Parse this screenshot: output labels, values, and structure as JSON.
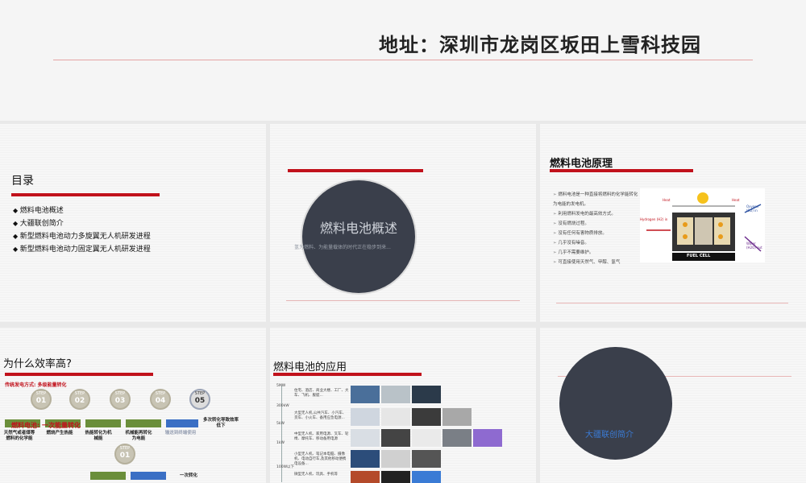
{
  "header": {
    "title": "地址：深圳市龙岗区坂田上雪科技园"
  },
  "slide1": {
    "title": "目录",
    "items": [
      "燃料电池概述",
      "大疆联创简介",
      "新型燃料电池动力多旋翼无人机研发进程",
      "新型燃料电池动力固定翼无人机研发进程"
    ]
  },
  "slide2": {
    "title": "燃料电池概述",
    "subtitle": "氢为燃料、为能量载体的时代正在稳步到来..."
  },
  "slide3": {
    "title": "燃料电池原理",
    "bullets": [
      "燃料电池是一种直接将燃料的化学能转化为电能的发电机。",
      "利用燃料发电的最高效方式。",
      "没有燃烧过程。",
      "没有任何有害物质排放。",
      "几乎没有噪音。",
      "几乎不需要维护。",
      "可直接使用天然气、甲醇、氢气"
    ],
    "diagram": {
      "label": "FUEL CELL",
      "hydrogen": "Hydrogen (H2) in",
      "oxygen": "Oxygen (O2) in",
      "water": "Water (H2O) out",
      "heat_left": "Heat",
      "heat_right": "Heat"
    }
  },
  "slide4": {
    "title": "为什么效率高?",
    "subtitle": "传统发电方式: 多级能量转化",
    "steps": [
      {
        "tag": "STEP",
        "num": "01"
      },
      {
        "tag": "STEP",
        "num": "02"
      },
      {
        "tag": "STEP",
        "num": "03"
      },
      {
        "tag": "STEP",
        "num": "04"
      },
      {
        "tag": "STEP",
        "num": "05"
      }
    ],
    "labels": [
      "天然气或者煤等燃料的化学能",
      "燃烧产生热能",
      "热能转化为机械能",
      "机械能再转化为电能",
      "输送到终端使用",
      "多次转化导致效率低下"
    ],
    "overlay": "燃料电池: 一次能量转化",
    "bottom_step": {
      "tag": "STEP",
      "num": "01"
    },
    "bottom_label": "一次转化"
  },
  "slide5": {
    "title": "燃料电池的应用",
    "yticks": [
      "5MW",
      "300kW",
      "5kW",
      "1kW",
      "100W以下"
    ],
    "rows": [
      "住宅、酒店、商业大楼、工厂、大车、飞机、舰艇...",
      "大型无人机,公共汽车、小汽车、货车、小火车、备用应急电源...",
      "中型无人机、家用电源、叉车、轮椅、摩托车、移动备用电源",
      "小型无人机、笔记本电脑、摄像机、电动自行车,及其他移动便携电设备...",
      "微型无人机、玩具、手机等"
    ]
  },
  "slide6": {
    "title": "大疆联创简介"
  },
  "colors": {
    "accent": "#c1121c",
    "circle": "#3a3f4b",
    "link": "#3a7bd5"
  }
}
